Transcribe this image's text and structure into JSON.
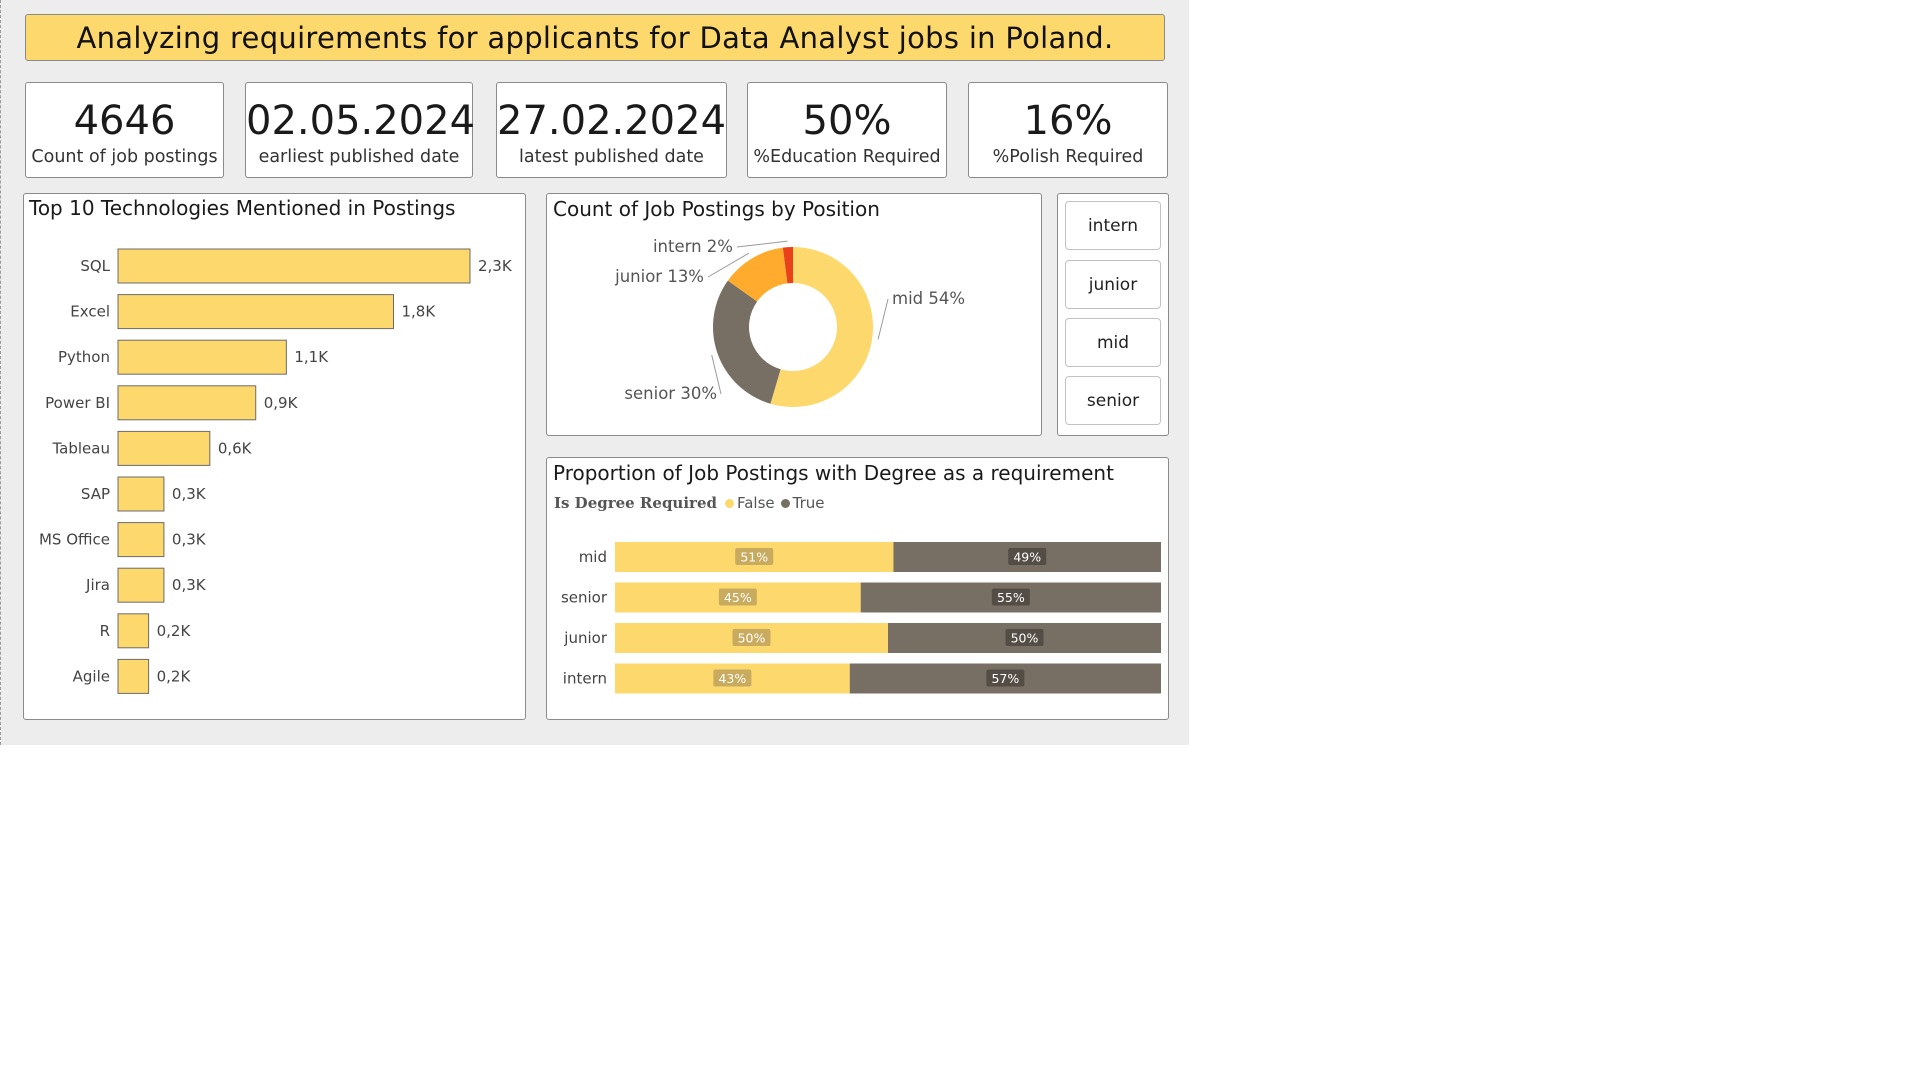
{
  "header": {
    "title": "Analyzing requirements for applicants for Data Analyst jobs in Poland."
  },
  "kpis": [
    {
      "value": "4646",
      "label": "Count of job postings"
    },
    {
      "value": "02.05.2024",
      "label": "earliest published date"
    },
    {
      "value": "27.02.2024",
      "label": "latest published date"
    },
    {
      "value": "50%",
      "label": "%Education Required"
    },
    {
      "value": "16%",
      "label": "%Polish Required"
    }
  ],
  "slicer": {
    "items": [
      "intern",
      "junior",
      "mid",
      "senior"
    ]
  },
  "colors": {
    "yellow": "#fdd86c",
    "gray": "#776f63",
    "orange": "#ffab2e",
    "red": "#e8411c",
    "canvas": "#eeedee"
  },
  "chart_data": [
    {
      "type": "bar",
      "orientation": "horizontal",
      "title": "Top 10 Technologies Mentioned in Postings",
      "categories": [
        "SQL",
        "Excel",
        "Python",
        "Power BI",
        "Tableau",
        "SAP",
        "MS Office",
        "Jira",
        "R",
        "Agile"
      ],
      "values": [
        2300,
        1800,
        1100,
        900,
        600,
        300,
        300,
        300,
        200,
        200
      ],
      "value_labels": [
        "2,3K",
        "1,8K",
        "1,1K",
        "0,9K",
        "0,6K",
        "0,3K",
        "0,3K",
        "0,3K",
        "0,2K",
        "0,2K"
      ],
      "color": "#fdd86c",
      "grid": false
    },
    {
      "type": "pie",
      "donut": true,
      "title": "Count of Job Postings by Position",
      "categories": [
        "mid",
        "senior",
        "junior",
        "intern"
      ],
      "values": [
        54,
        30,
        13,
        2
      ],
      "labels": [
        "mid 54%",
        "senior 30%",
        "junior 13%",
        "intern 2%"
      ],
      "colors": [
        "#fdd86c",
        "#776f63",
        "#ffab2e",
        "#e8411c"
      ]
    },
    {
      "type": "bar",
      "orientation": "horizontal",
      "stacked": "100%",
      "title": "Proportion of Job Postings with Degree as a requirement",
      "legend_title": "Is Degree Required",
      "legend_placement": "top-left",
      "categories": [
        "mid",
        "senior",
        "junior",
        "intern"
      ],
      "series": [
        {
          "name": "False",
          "values": [
            51,
            45,
            50,
            43
          ],
          "labels": [
            "51%",
            "45%",
            "50%",
            "43%"
          ],
          "color": "#fdd86c"
        },
        {
          "name": "True",
          "values": [
            49,
            55,
            50,
            57
          ],
          "labels": [
            "49%",
            "55%",
            "50%",
            "57%"
          ],
          "color": "#776f63"
        }
      ]
    }
  ]
}
